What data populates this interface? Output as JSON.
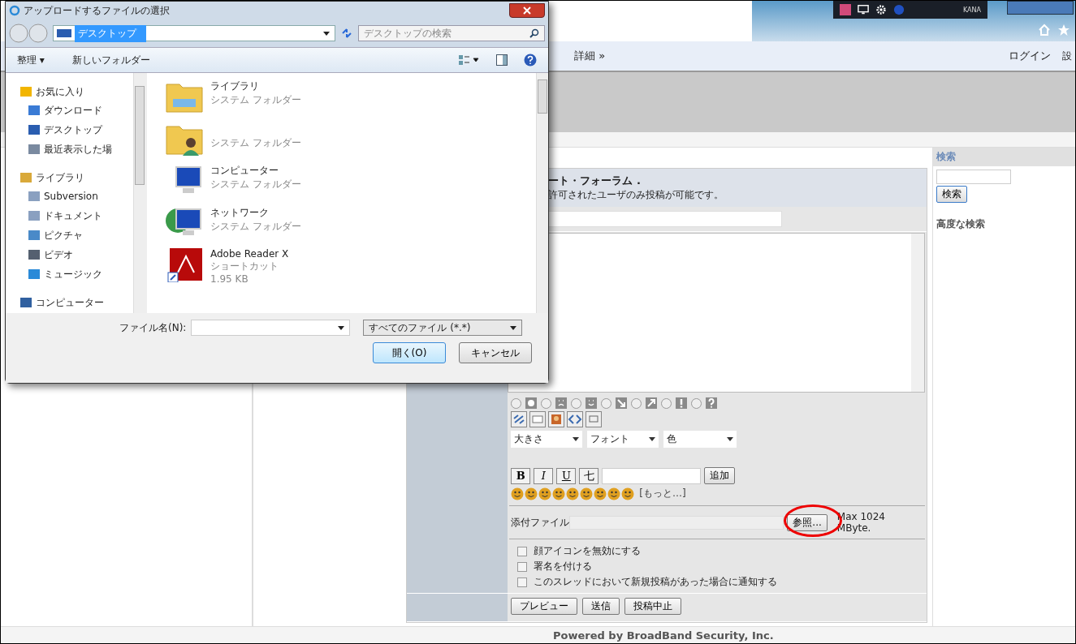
{
  "browser": {
    "ime_mode": "KANA",
    "menu": {
      "more": "詳細 »",
      "login": "ログイン",
      "settings": "設"
    }
  },
  "form": {
    "title": "ート・フォーラム .",
    "notice": "許可されたユーザのみ投稿が可能です。",
    "post_icons": [
      {
        "kind": "plain",
        "selected": false
      },
      {
        "kind": "sad",
        "selected": false
      },
      {
        "kind": "smile",
        "selected": false
      },
      {
        "kind": "down",
        "selected": false
      },
      {
        "kind": "up",
        "selected": false
      },
      {
        "kind": "exclaim",
        "selected": false
      },
      {
        "kind": "question",
        "selected": false
      }
    ],
    "selects": [
      "大きさ",
      "フォント",
      "色"
    ],
    "format_buttons": [
      {
        "label": "B",
        "kind": "bold"
      },
      {
        "label": "I",
        "kind": "italic"
      },
      {
        "label": "U",
        "kind": "underline"
      },
      {
        "label": "七",
        "kind": "plain"
      }
    ],
    "add_button": "追加",
    "more_link": "[もっと…]",
    "attach_label": "添付ファイル",
    "browse_button": "参照...",
    "limit": "Max 1024 MByte.",
    "options": [
      {
        "label": "顔アイコンを無効にする",
        "checked": false
      },
      {
        "label": "署名を付ける",
        "checked": false
      },
      {
        "label": "このスレッドにおいて新規投稿があった場合に通知する",
        "checked": false
      }
    ],
    "buttons": [
      "プレビュー",
      "送信",
      "投稿中止"
    ]
  },
  "sidebar": {
    "heading": "検索",
    "button": "検索",
    "link": "高度な検索"
  },
  "footer": "Powered by BroadBand Security, Inc.",
  "dialog": {
    "title": "アップロードするファイルの選択",
    "address": {
      "path": "デスクトップ",
      "selected": true
    },
    "search": {
      "placeholder": "デスクトップの検索"
    },
    "toolbar": {
      "organize": "整理 ▾",
      "new_folder": "新しいフォルダー"
    },
    "nav": [
      {
        "label": "お気に入り",
        "kind": "star",
        "children": [
          {
            "label": "ダウンロード",
            "kind": "download"
          },
          {
            "label": "デスクトップ",
            "kind": "desktop"
          },
          {
            "label": "最近表示した場",
            "kind": "recent"
          }
        ]
      },
      {
        "label": "ライブラリ",
        "kind": "library",
        "children": [
          {
            "label": "Subversion",
            "kind": "doc"
          },
          {
            "label": "ドキュメント",
            "kind": "doc"
          },
          {
            "label": "ピクチャ",
            "kind": "picture"
          },
          {
            "label": "ビデオ",
            "kind": "video"
          },
          {
            "label": "ミュージック",
            "kind": "music"
          }
        ]
      },
      {
        "label": "コンピューター",
        "kind": "computer"
      }
    ],
    "files": [
      {
        "name": "ライブラリ",
        "kind": "library",
        "details": [
          "システム フォルダー"
        ]
      },
      {
        "kind": "user",
        "details": [
          "システム フォルダー"
        ]
      },
      {
        "name": "コンピューター",
        "kind": "computer",
        "details": [
          "システム フォルダー"
        ]
      },
      {
        "name": "ネットワーク",
        "kind": "network",
        "details": [
          "システム フォルダー"
        ]
      },
      {
        "name": "Adobe Reader X",
        "kind": "pdf",
        "details": [
          "ショートカット",
          "1.95 KB"
        ]
      }
    ],
    "filename_label": "ファイル名(N):",
    "filter": "すべてのファイル (*.*)",
    "open_button": "開く(O)",
    "cancel_button": "キャンセル"
  }
}
